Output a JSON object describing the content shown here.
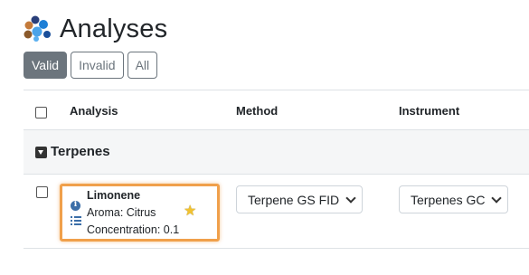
{
  "page": {
    "title": "Analyses"
  },
  "filters": [
    {
      "label": "Valid",
      "active": true
    },
    {
      "label": "Invalid",
      "active": false
    },
    {
      "label": "All",
      "active": false
    }
  ],
  "table": {
    "columns": {
      "analysis": "Analysis",
      "method": "Method",
      "instrument": "Instrument"
    },
    "group": {
      "label": "Terpenes"
    },
    "row": {
      "name": "Limonene",
      "aroma": "Aroma: Citrus",
      "concentration": "Concentration: 0.1",
      "method_selected": "Terpene GS FID",
      "instrument_selected": "Terpenes GC"
    }
  },
  "colors": {
    "highlight": "#f0a04b",
    "button_active": "#6c757d",
    "icon_blue": "#3b6ea8",
    "star": "#f2c230"
  }
}
